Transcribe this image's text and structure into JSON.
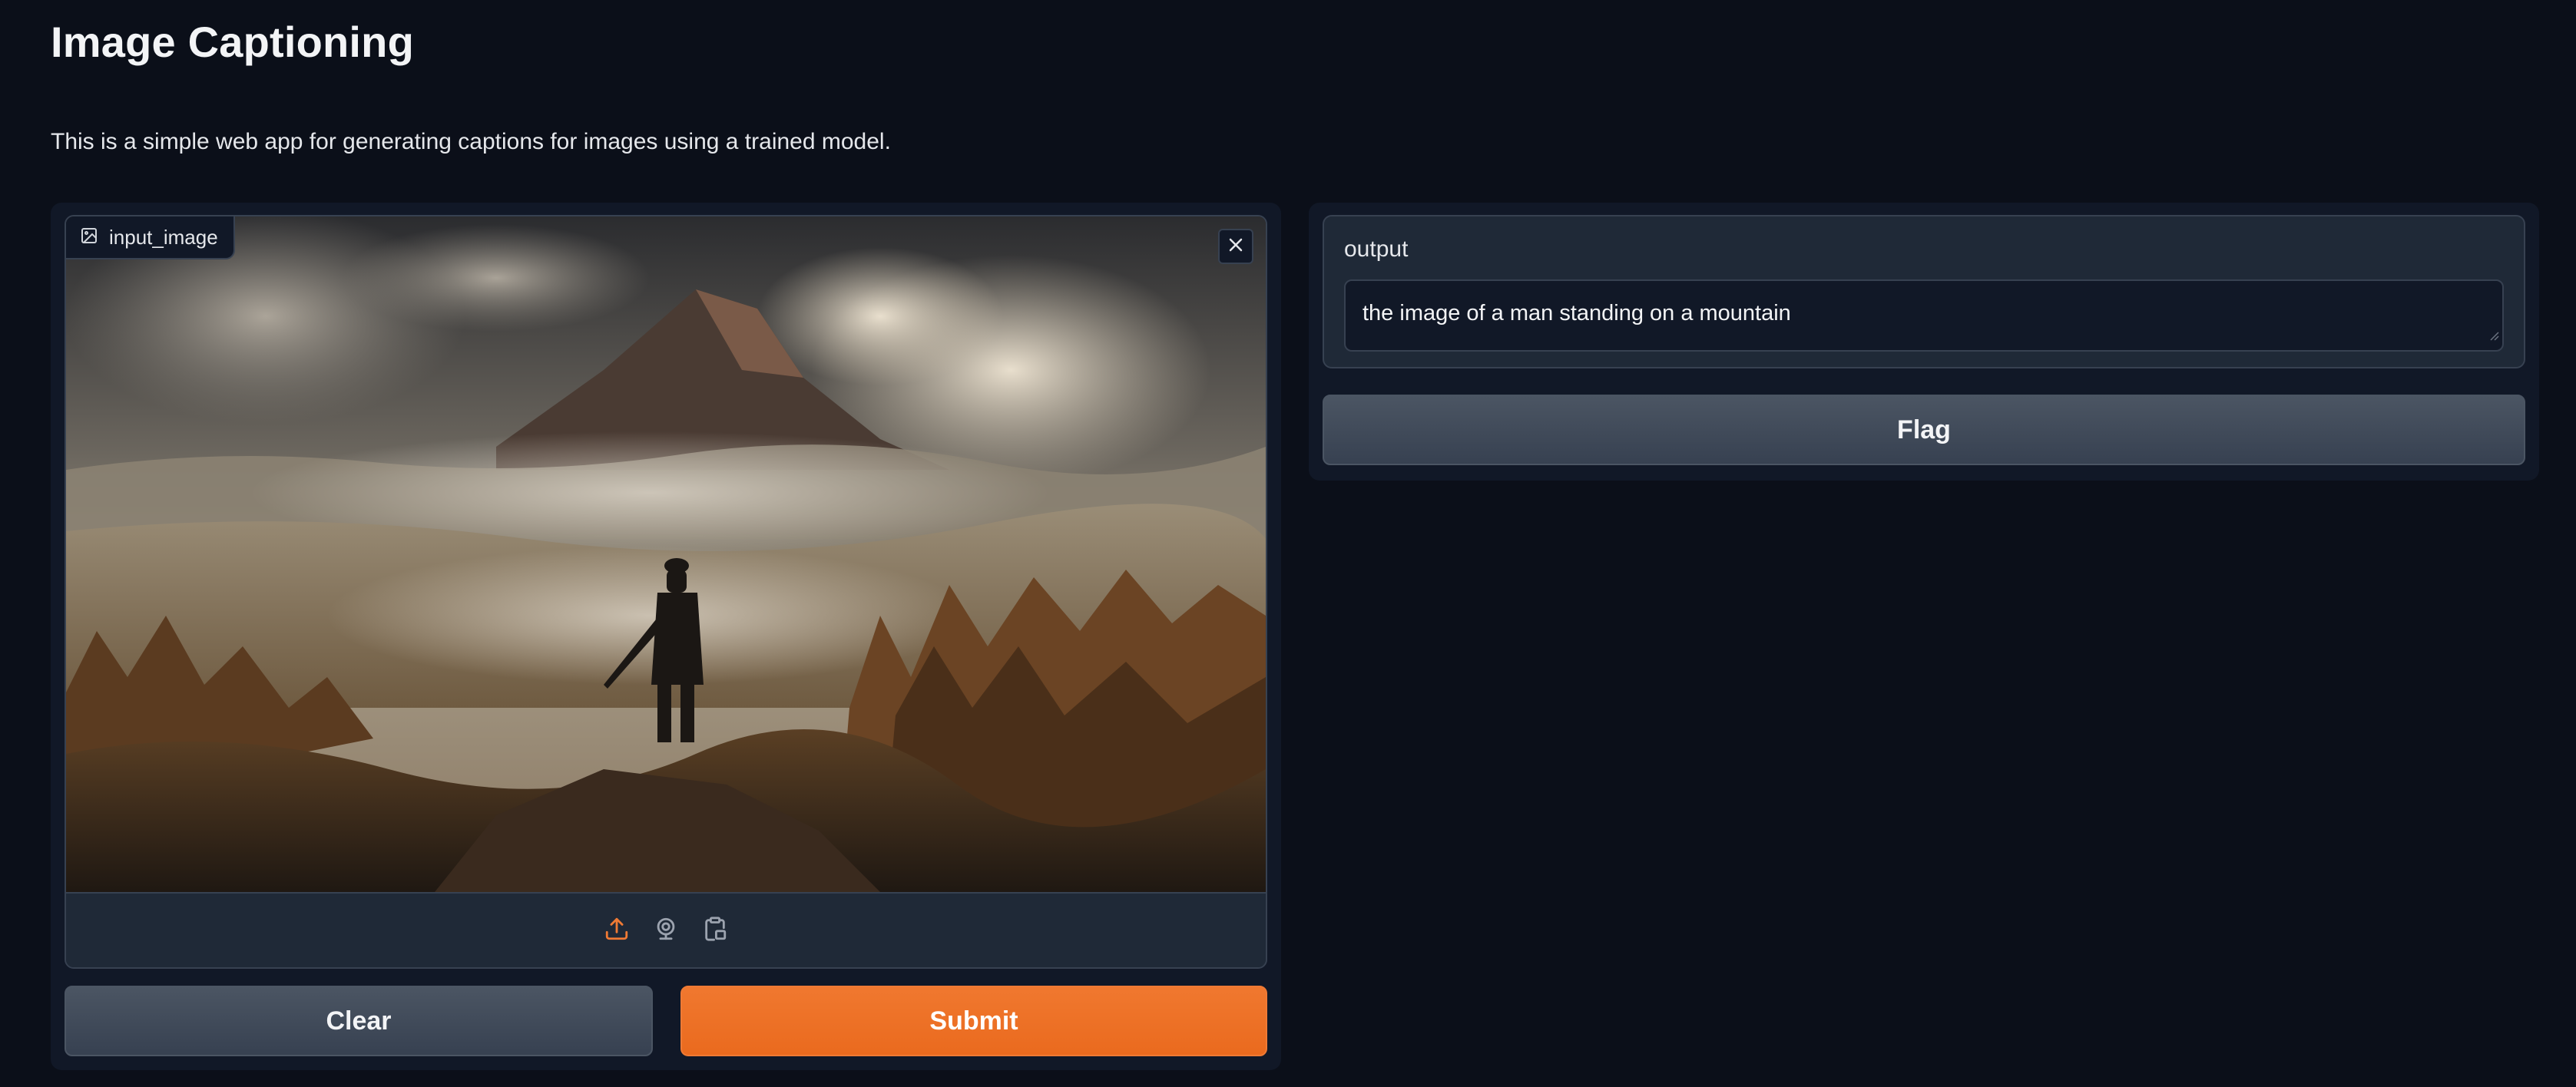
{
  "app": {
    "title": "Image Captioning",
    "description": "This is a simple web app for generating captions for images using a trained model."
  },
  "input": {
    "label": "input_image",
    "label_icon": "image-icon",
    "close_icon": "close-icon",
    "sources": [
      {
        "name": "upload-icon",
        "active": true
      },
      {
        "name": "webcam-icon",
        "active": false
      },
      {
        "name": "clipboard-icon",
        "active": false
      }
    ]
  },
  "buttons": {
    "clear": "Clear",
    "submit": "Submit",
    "flag": "Flag"
  },
  "output": {
    "label": "output",
    "value": "the image of a man standing on a mountain"
  },
  "colors": {
    "background": "#0b0f19",
    "panel": "#111827",
    "accent": "#ea6a1e",
    "secondary_button": "#4b5563"
  }
}
